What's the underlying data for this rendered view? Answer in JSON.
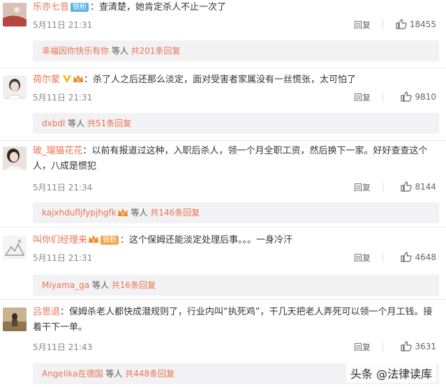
{
  "comments": [
    {
      "user": "乐亦七音",
      "badge": "铁粉",
      "text": "：查清楚，她肯定杀人不止一次了",
      "time": "5月11日 21:31",
      "reply_label": "回复",
      "likes": "18455",
      "thread": {
        "user": "幸福因你快乐有你",
        "mid": " 等人 ",
        "count": "共201条回复"
      }
    },
    {
      "user": "荷尔蒙",
      "text": "：杀了人之后还那么淡定，面对受害者家属没有一丝慌张，太可怕了",
      "time": "5月11日 21:31",
      "reply_label": "回复",
      "likes": "9810",
      "thread": {
        "user": "dxbdl",
        "mid": " 等人 ",
        "count": "共51条回复"
      }
    },
    {
      "user": "玻_瑠猫花花",
      "text": "：以前有报道过这种，入职后杀人，领一个月全职工资，然后换下一家。好好查查这个人，八成是惯犯",
      "time": "5月11日 21:34",
      "reply_label": "回复",
      "likes": "8144",
      "thread": {
        "user": "kajxhdufljfypjhgfk",
        "mid": " 等人 ",
        "count": "共146条回复"
      }
    },
    {
      "user": "叫你们经理来",
      "badge": "铁粉",
      "text": "：这个保姆还能淡定处理后事。。。一身冷汗",
      "time": "5月11日 21:31",
      "reply_label": "回复",
      "likes": "4648",
      "thread": {
        "user": "Miyama_ga",
        "mid": " 等人 ",
        "count": "共16条回复"
      }
    },
    {
      "user": "吕思退",
      "text": "：保姆杀老人都快成潜规则了，行业内叫“执死鸡”，干几天把老人弄死可以领一个月工钱。接着干下一单。",
      "time": "5月11日 21:43",
      "reply_label": "回复",
      "likes": "3631",
      "thread": {
        "user": "Angelika在德国",
        "mid": " 等人 ",
        "count": "共448条回复"
      }
    }
  ],
  "watermark": "头条 @法律读库",
  "colors": {
    "username": "#eb7350",
    "reply_bg": "#f2f2f5",
    "fan_badge": "#5fb4e6"
  }
}
